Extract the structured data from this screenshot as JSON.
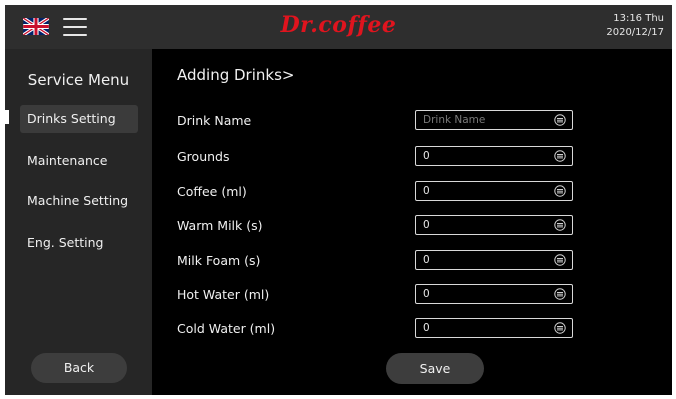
{
  "header": {
    "brand": "Dr.coffee",
    "time": "13:16 Thu",
    "date": "2020/12/17",
    "language_icon": "uk-flag-icon",
    "menu_icon": "hamburger-menu-icon"
  },
  "sidebar": {
    "title": "Service Menu",
    "items": [
      {
        "label": "Drinks Setting",
        "active": true
      },
      {
        "label": "Maintenance",
        "active": false
      },
      {
        "label": "Machine Setting",
        "active": false
      },
      {
        "label": "Eng. Setting",
        "active": false
      }
    ],
    "back_label": "Back"
  },
  "main": {
    "title": "Adding Drinks>",
    "fields": [
      {
        "label": "Drink Name",
        "value": "",
        "placeholder": "Drink Name"
      },
      {
        "label": "Grounds",
        "value": "0",
        "placeholder": ""
      },
      {
        "label": "Coffee (ml)",
        "value": "0",
        "placeholder": ""
      },
      {
        "label": "Warm Milk (s)",
        "value": "0",
        "placeholder": ""
      },
      {
        "label": "Milk Foam (s)",
        "value": "0",
        "placeholder": ""
      },
      {
        "label": "Hot Water (ml)",
        "value": "0",
        "placeholder": ""
      },
      {
        "label": "Cold Water (ml)",
        "value": "0",
        "placeholder": ""
      }
    ],
    "field_icon": "keyboard-icon",
    "save_label": "Save"
  },
  "colors": {
    "brand": "#e0141e",
    "topbar": "#2e2e2e",
    "sidebar": "#262626",
    "background": "#000000",
    "button": "#3d3d3d"
  }
}
